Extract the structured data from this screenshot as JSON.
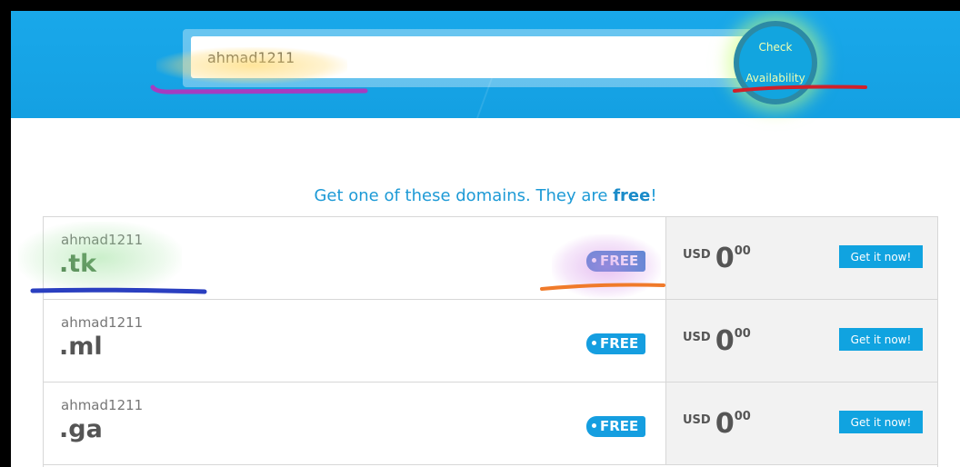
{
  "search": {
    "value": "ahmad1211",
    "button_line1": "Check",
    "button_line2": "Availability"
  },
  "intro": {
    "text": "Get one of these domains. They are ",
    "bold": "free",
    "end": "!"
  },
  "domains": [
    {
      "name": "ahmad1211",
      "tld": ".tk",
      "badge": "FREE",
      "currency": "USD",
      "amount": "0",
      "cents": "00",
      "action": "Get it now!"
    },
    {
      "name": "ahmad1211",
      "tld": ".ml",
      "badge": "FREE",
      "currency": "USD",
      "amount": "0",
      "cents": "00",
      "action": "Get it now!"
    },
    {
      "name": "ahmad1211",
      "tld": ".ga",
      "badge": "FREE",
      "currency": "USD",
      "amount": "0",
      "cents": "00",
      "action": "Get it now!"
    }
  ],
  "colors": {
    "hero_blue": "#19a8ea",
    "accent_blue": "#159ee0",
    "annotation_purple": "#a63cc0",
    "annotation_red": "#d0202a",
    "annotation_blue": "#2a3fc0",
    "annotation_orange": "#f07a2a"
  }
}
